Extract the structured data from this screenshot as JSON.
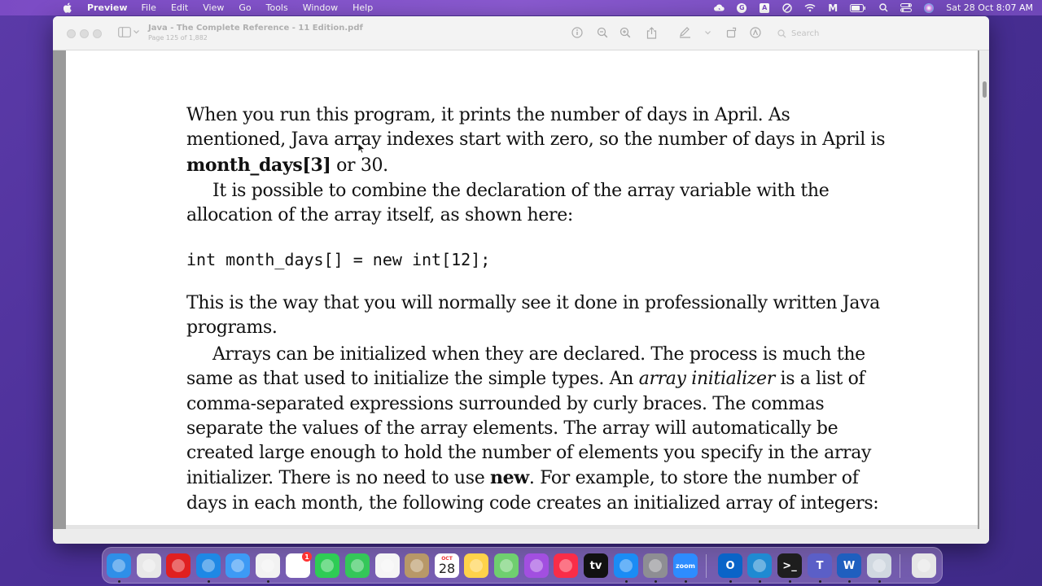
{
  "menubar": {
    "app_name": "Preview",
    "items": [
      "File",
      "Edit",
      "View",
      "Go",
      "Tools",
      "Window",
      "Help"
    ],
    "clock": "Sat 28 Oct  8:07 AM",
    "status_icons": [
      "cloud-icon",
      "grammarly-icon",
      "text-icon",
      "lock-icon",
      "wifi-icon",
      "m-icon",
      "battery-icon",
      "search-icon",
      "control-center-icon",
      "siri-icon"
    ],
    "status_glyphs": {
      "grammarly": "G",
      "text": "A",
      "m": "M"
    }
  },
  "window": {
    "title": "Java - The Complete Reference - 11 Edition.pdf",
    "subtitle": "Page 125 of 1,882",
    "search_placeholder": "Search",
    "toolbar_icons": [
      "info-icon",
      "zoom-out-icon",
      "zoom-in-icon",
      "share-icon",
      "markup-icon",
      "chevron-down-icon",
      "rotate-icon",
      "annotate-icon"
    ]
  },
  "document": {
    "para1": {
      "line1": "When you run this program, it prints the number of days in April. As",
      "line2": "mentioned, Java array indexes start with zero, so the number of days in April is",
      "line3_bold": "month_days[3]",
      "line3_rest": " or 30."
    },
    "para2": {
      "line1": "It is possible to combine the declaration of the array variable with the",
      "line2": "allocation of the array itself, as shown here:"
    },
    "code": "int month_days[] = new int[12];",
    "para3": {
      "line1": "This is the way that you will normally see it done in professionally written Java",
      "line2": "programs."
    },
    "para4": {
      "line1": "Arrays can be initialized when they are declared. The process is much the",
      "line2_a": "same as that used to initialize the simple types. An ",
      "line2_italic": "array initializer",
      "line2_b": " is a list of",
      "line3": "comma-separated expressions surrounded by curly braces. The commas",
      "line4": "separate the values of the array elements. The array will automatically be",
      "line5": "created large enough to hold the number of elements you specify in the array",
      "line6_a": "initializer. There is no need to use ",
      "line6_bold": "new",
      "line6_b": ". For example, to store the number of",
      "line7": "days in each month, the following code creates an initialized array of integers:"
    }
  },
  "dock": {
    "apps": [
      {
        "name": "finder-icon",
        "color": "#2f8fe8"
      },
      {
        "name": "launchpad-icon",
        "color": "#e8e8e8"
      },
      {
        "name": "opera-icon",
        "color": "#e02020"
      },
      {
        "name": "safari-icon",
        "color": "#1e88e5"
      },
      {
        "name": "mail-icon",
        "color": "#3d9af5"
      },
      {
        "name": "chrome-icon",
        "color": "#f2f2f2"
      },
      {
        "name": "reminders-icon",
        "color": "#ffffff",
        "badge": "1"
      },
      {
        "name": "facetime-icon",
        "color": "#2ecc55"
      },
      {
        "name": "messages-icon",
        "color": "#34c759"
      },
      {
        "name": "photos-icon",
        "color": "#f5f5f5"
      },
      {
        "name": "tinder-icon",
        "color": "#b89868"
      },
      {
        "name": "calendar-icon",
        "color": "#ffffff",
        "month": "OCT",
        "day": "28"
      },
      {
        "name": "notes-icon",
        "color": "#ffd24a"
      },
      {
        "name": "maps-icon",
        "color": "#6fcf6f"
      },
      {
        "name": "podcasts-icon",
        "color": "#a24fe0"
      },
      {
        "name": "music-icon",
        "color": "#fa2d48"
      },
      {
        "name": "tv-icon",
        "color": "#111111",
        "label": "tv"
      },
      {
        "name": "app-store-icon",
        "color": "#1b8cf5"
      },
      {
        "name": "system-settings-icon",
        "color": "#8e8e93"
      },
      {
        "name": "zoom-icon",
        "color": "#2d8cff",
        "label": "zoom"
      },
      {
        "name": "outlook-icon",
        "color": "#0a64c8",
        "label": "O"
      },
      {
        "name": "vscode-icon",
        "color": "#1f8ad2"
      },
      {
        "name": "terminal-icon",
        "color": "#1e1e1e",
        "label": ">_"
      },
      {
        "name": "teams-icon",
        "color": "#5b5fc7",
        "label": "T"
      },
      {
        "name": "word-icon",
        "color": "#1f5fbf",
        "label": "W"
      },
      {
        "name": "preview-icon",
        "color": "#d0d8e0"
      },
      {
        "name": "trash-icon",
        "color": "#e6e6e6"
      }
    ]
  }
}
